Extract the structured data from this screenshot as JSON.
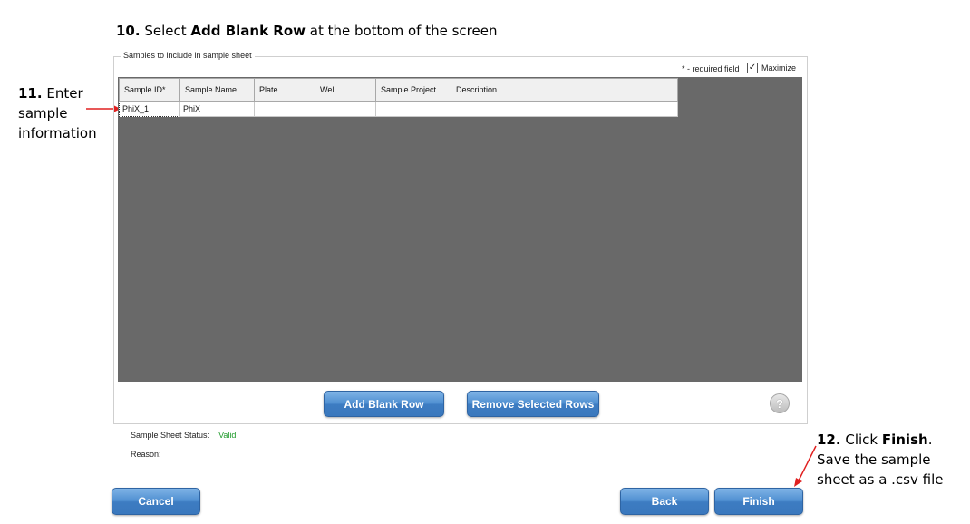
{
  "instructions": {
    "step10_num": "10.",
    "step10_pre": " Select ",
    "step10_bold": "Add Blank Row",
    "step10_post": " at the bottom of the screen",
    "step11_num": "11.",
    "step11_text": " Enter sample information",
    "step12_num": "12.",
    "step12_pre": " Click ",
    "step12_bold": "Finish",
    "step12_post": ".",
    "step12_line2": "Save the sample sheet as a .csv file"
  },
  "panel": {
    "legend": "Samples to include in sample sheet",
    "required_note": "* - required field",
    "maximize_label": "Maximize",
    "maximize_checked": true
  },
  "table": {
    "columns": [
      "Sample ID*",
      "Sample Name",
      "Plate",
      "Well",
      "Sample Project",
      "Description"
    ],
    "rows": [
      [
        "PhiX_1",
        "PhiX",
        "",
        "",
        "",
        ""
      ]
    ]
  },
  "buttons": {
    "add_blank_row": "Add Blank Row",
    "remove_selected_rows": "Remove Selected Rows",
    "help": "?",
    "cancel": "Cancel",
    "back": "Back",
    "finish": "Finish"
  },
  "status": {
    "label": "Sample Sheet Status:",
    "value": "Valid",
    "reason_label": "Reason:"
  },
  "colors": {
    "valid_text": "#1e9a2a",
    "arrow": "#e02020",
    "button_blue": "#4f8fd1",
    "grid_background": "#696969"
  }
}
